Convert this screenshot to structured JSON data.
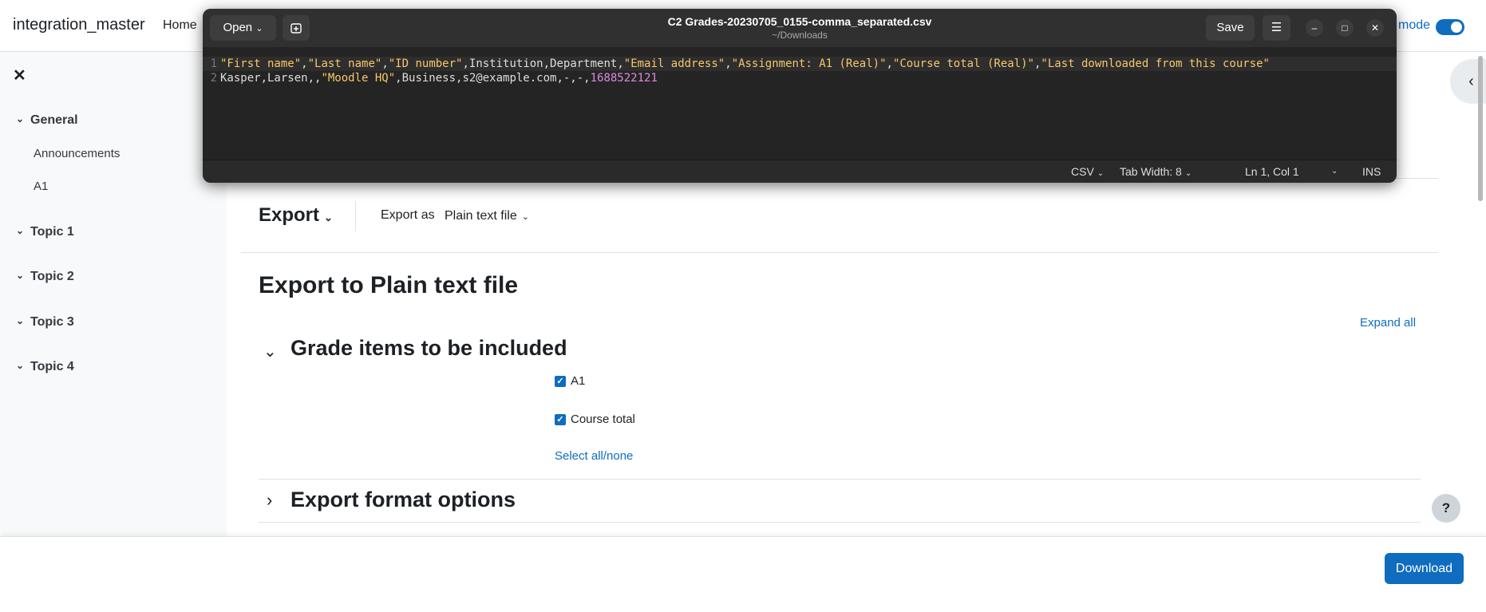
{
  "navbar": {
    "site_name": "integration_master",
    "home": "Home",
    "edit_mode": "mode"
  },
  "drawer": {
    "close": "✕",
    "sections": [
      {
        "label": "General",
        "items": [
          "Announcements",
          "A1"
        ]
      },
      {
        "label": "Topic 1"
      },
      {
        "label": "Topic 2"
      },
      {
        "label": "Topic 3"
      },
      {
        "label": "Topic 4"
      }
    ]
  },
  "main": {
    "export_menu": "Export",
    "export_as_label": "Export as",
    "export_as_value": "Plain text file",
    "page_title": "Export to Plain text file",
    "expand_all": "Expand all",
    "grade_items_header": "Grade items to be included",
    "items": [
      "A1",
      "Course total"
    ],
    "select_all": "Select all/none",
    "format_header": "Export format options",
    "help": "?"
  },
  "footer": {
    "download": "Download"
  },
  "editor": {
    "open": "Open",
    "title": "C2 Grades-20230705_0155-comma_separated.csv",
    "subtitle": "~/Downloads",
    "save": "Save",
    "line_numbers": [
      "1",
      "2"
    ],
    "line1": {
      "s1": "\"First name\"",
      "c1": ",",
      "s2": "\"Last name\"",
      "c2": ",",
      "s3": "\"ID number\"",
      "t1": ",Institution,Department,",
      "s4": "\"Email address\"",
      "c4": ",",
      "s5": "\"Assignment: A1 (Real)\"",
      "c5": ",",
      "s6": "\"Course total (Real)\"",
      "c6": ",",
      "s7": "\"Last downloaded from this course\""
    },
    "line2": {
      "t1": "Kasper,Larsen,,",
      "s1": "\"Moodle HQ\"",
      "t2": ",Business,s2@example.com,-,-,",
      "n1": "1688522121"
    },
    "status": {
      "language": "CSV",
      "tab_width": "Tab Width: 8",
      "position": "Ln 1, Col 1",
      "mode": "INS"
    }
  }
}
